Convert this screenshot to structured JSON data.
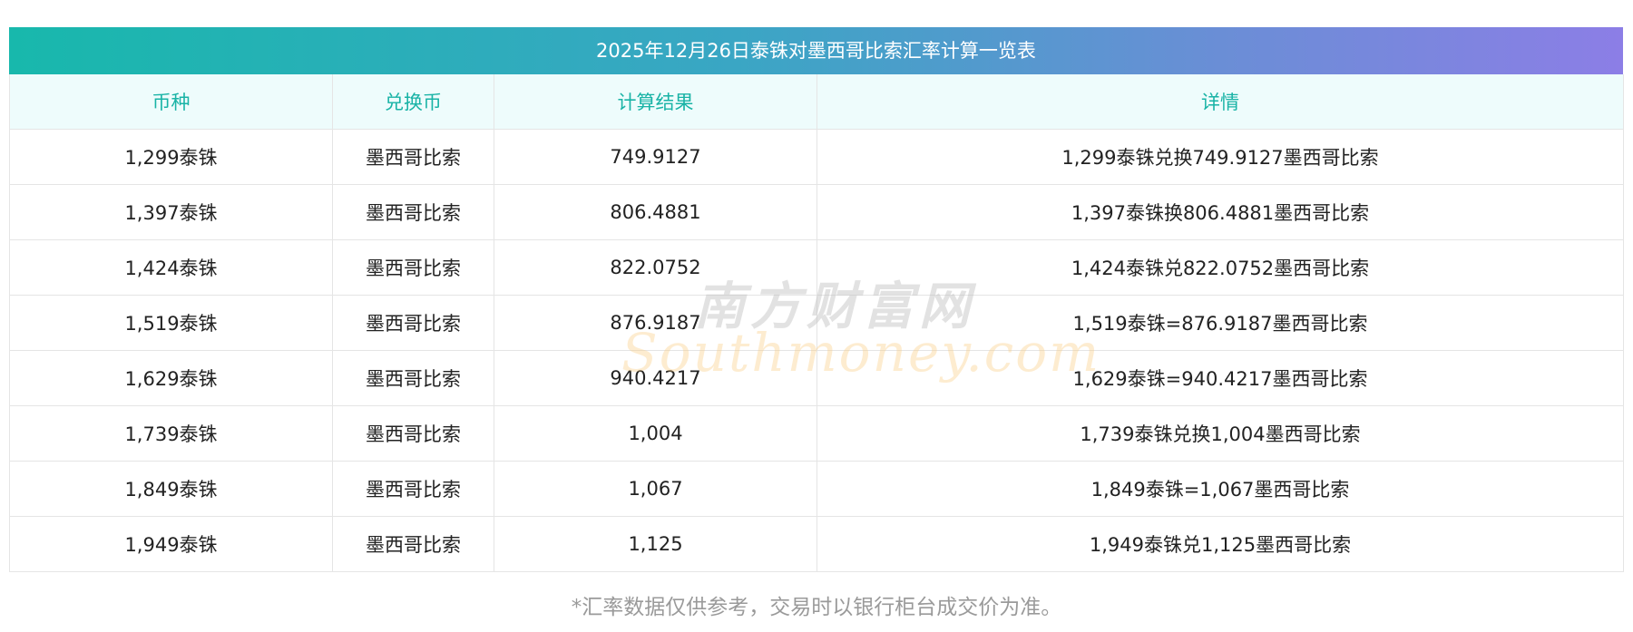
{
  "title": "2025年12月26日泰铢对墨西哥比索汇率计算一览表",
  "columns": [
    "币种",
    "兑换币",
    "计算结果",
    "详情"
  ],
  "rows": [
    [
      "1,299泰铢",
      "墨西哥比索",
      "749.9127",
      "1,299泰铢兑换749.9127墨西哥比索"
    ],
    [
      "1,397泰铢",
      "墨西哥比索",
      "806.4881",
      "1,397泰铢换806.4881墨西哥比索"
    ],
    [
      "1,424泰铢",
      "墨西哥比索",
      "822.0752",
      "1,424泰铢兑822.0752墨西哥比索"
    ],
    [
      "1,519泰铢",
      "墨西哥比索",
      "876.9187",
      "1,519泰铢=876.9187墨西哥比索"
    ],
    [
      "1,629泰铢",
      "墨西哥比索",
      "940.4217",
      "1,629泰铢=940.4217墨西哥比索"
    ],
    [
      "1,739泰铢",
      "墨西哥比索",
      "1,004",
      "1,739泰铢兑换1,004墨西哥比索"
    ],
    [
      "1,849泰铢",
      "墨西哥比索",
      "1,067",
      "1,849泰铢=1,067墨西哥比索"
    ],
    [
      "1,949泰铢",
      "墨西哥比索",
      "1,125",
      "1,949泰铢兑1,125墨西哥比索"
    ]
  ],
  "footnote": "*汇率数据仅供参考，交易时以银行柜台成交价为准。",
  "watermark": {
    "cn": "南方财富网",
    "en": "Southmoney.com"
  },
  "colors": {
    "header_text": "#19b3a6",
    "header_bg": "#eefcfc",
    "title_gradient_start": "#18b8ac",
    "title_gradient_end": "#8c7ee6"
  }
}
